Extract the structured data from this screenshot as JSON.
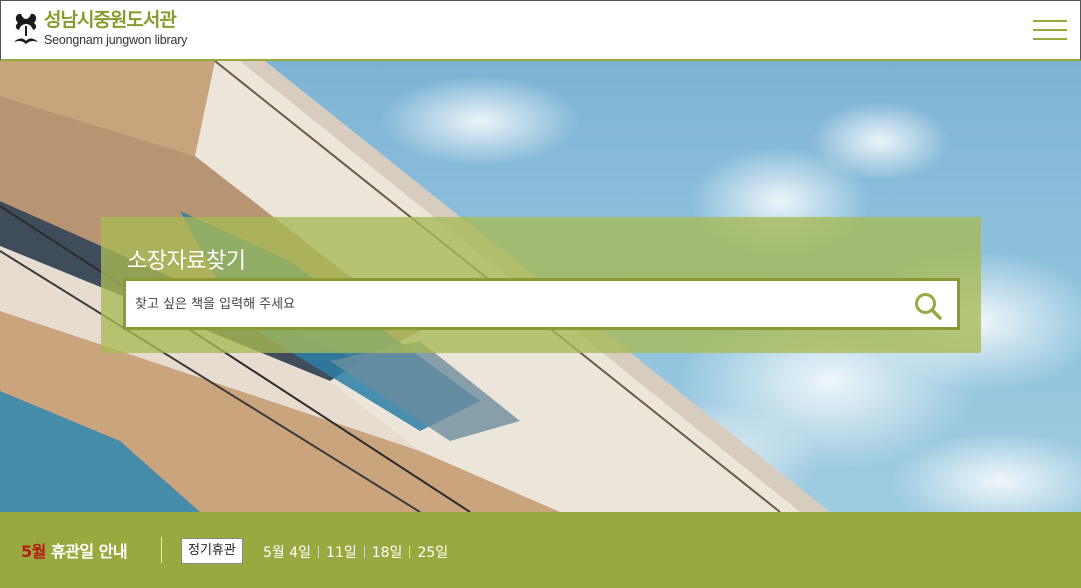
{
  "header": {
    "logo_ko": "성남시중원도서관",
    "logo_en": "Seongnam jungwon library",
    "menu_icon": "hamburger-menu-icon"
  },
  "colors": {
    "accent": "#9aa93f",
    "logo_text": "#8a9a2e",
    "month_highlight": "#b21e12"
  },
  "search": {
    "title": "소장자료찾기",
    "placeholder": "찾고 싶은 책을 입력해 주세요",
    "value": "",
    "button_icon": "search-icon"
  },
  "closure": {
    "month": "5월",
    "title": "휴관일 안내",
    "badge": "정기휴관",
    "dates": [
      "5월 4일",
      "11일",
      "18일",
      "25일"
    ]
  }
}
